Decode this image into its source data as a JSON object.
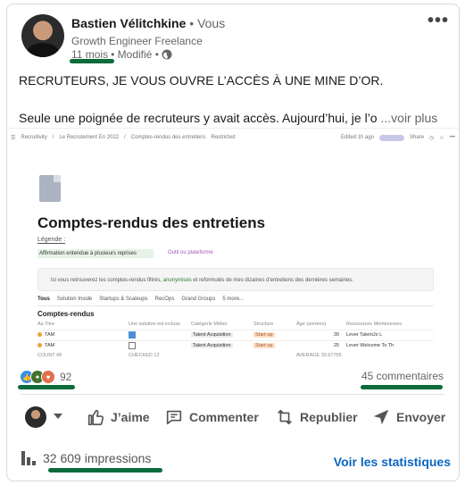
{
  "post": {
    "author": "Bastien Vélitchkine",
    "you_label": "• Vous",
    "headline": "Growth Engineer Freelance",
    "age": "11 mois",
    "edited": "• Modifié •",
    "more_label": "•••",
    "text_line1": "RECRUTEURS, JE VOUS OUVRE L’ACCÈS À UNE MINE D’OR.",
    "text_line2": "Seule une poignée de recruteurs y avait accès. Aujourd’hui, je l’o",
    "see_more": "...voir plus"
  },
  "embed": {
    "breadcrumb_1": "Recruitivity",
    "breadcrumb_2": "Le Recrutement En 2022",
    "breadcrumb_3": "Comptes-rendus des entretiens",
    "breadcrumb_4": "Restricted",
    "top_right": "Edited 1h ago",
    "share": "Share",
    "title": "Comptes-rendus des entretiens",
    "legend": "Légende :",
    "legend_green": "Affirmation entendue à plusieurs reprises",
    "legend_tool": "Outil ou plateforme",
    "callout_a": "Ici vous retrouverez les comptes-rendus filtrés, ",
    "callout_hl": "anonymisés",
    "callout_b": " et reformulés de mes dizaines d'entretiens des dernières semaines.",
    "views": [
      "Tous",
      "Solution Inside",
      "Startups & Scaleups",
      "RecOps",
      "Grand Groups",
      "5 more..."
    ],
    "table_title": "Comptes-rendus",
    "columns": [
      "Aa Titre",
      "Une solution est incluse",
      "Catégorie Métier",
      "Structure",
      "Âge (années)",
      "Ressources Mentionnées"
    ],
    "rows": [
      {
        "title": "TAM",
        "checked": true,
        "category": "Talent Acquisition",
        "structure": "Start-up",
        "age": "30",
        "res": "Lever  TalentJo  L"
      },
      {
        "title": "TAM",
        "checked": false,
        "category": "Talent Acquisition",
        "structure": "Start-up",
        "age": "25",
        "res": "Lever  Welcome To Th"
      }
    ],
    "footer": [
      "COUNT 49",
      "CHECKED 12",
      "",
      "",
      "AVERAGE 30.67755",
      ""
    ]
  },
  "social": {
    "reactions_count": "92",
    "comments": "45 commentaires"
  },
  "actions": {
    "like": "J’aime",
    "comment": "Commenter",
    "repost": "Republier",
    "send": "Envoyer"
  },
  "stats": {
    "impressions": "32 609 impressions",
    "view_stats": "Voir les statistiques"
  },
  "colors": {
    "underline": "#0b6b3a",
    "link": "#0a66c2"
  }
}
